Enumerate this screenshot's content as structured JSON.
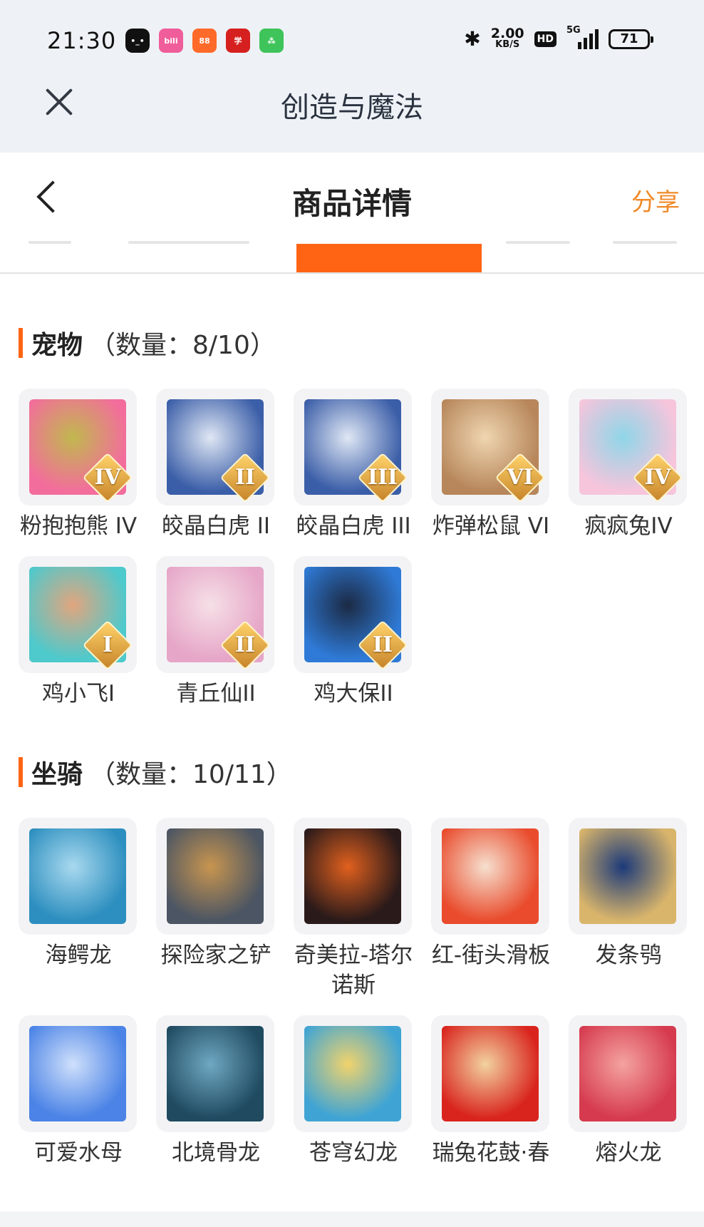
{
  "status_bar": {
    "time": "21:30",
    "notifications": [
      {
        "icon": "app-icon-black",
        "text": "•_•"
      },
      {
        "icon": "bilibili-icon",
        "text": "bili"
      },
      {
        "icon": "taobao-icon",
        "text": "88"
      },
      {
        "icon": "xuexi-icon",
        "text": "学"
      },
      {
        "icon": "wechat-app-icon",
        "text": "⁂"
      }
    ],
    "bluetooth": "✱",
    "speed_value": "2.00",
    "speed_unit": "KB/S",
    "hd": "HD",
    "network": "5G",
    "battery": "71"
  },
  "app_header": {
    "title": "创造与魔法"
  },
  "page_header": {
    "title": "商品详情",
    "share_label": "分享"
  },
  "pets": {
    "title": "宠物",
    "count": "（数量：8/10）",
    "items": [
      {
        "label": "粉抱抱熊 IV",
        "badge": "IV",
        "color1": "#f36d9c",
        "color2": "#c1b84e"
      },
      {
        "label": "皎晶白虎 II",
        "badge": "II",
        "color1": "#3b5ea8",
        "color2": "#dfe7f4"
      },
      {
        "label": "皎晶白虎 III",
        "badge": "III",
        "color1": "#3b5ea8",
        "color2": "#dfe7f4"
      },
      {
        "label": "炸弹松鼠 VI",
        "badge": "VI",
        "color1": "#b7865a",
        "color2": "#efd6b1"
      },
      {
        "label": "疯疯兔IV",
        "badge": "IV",
        "color1": "#f6c5dc",
        "color2": "#8fd6e8"
      },
      {
        "label": "鸡小飞I",
        "badge": "I",
        "color1": "#4ec9cc",
        "color2": "#e2a57e"
      },
      {
        "label": "青丘仙II",
        "badge": "II",
        "color1": "#e6a6c8",
        "color2": "#f6e0e6"
      },
      {
        "label": "鸡大保II",
        "badge": "II",
        "color1": "#2f7ad6",
        "color2": "#1b2a44"
      }
    ]
  },
  "mounts": {
    "title": "坐骑",
    "count": "（数量：10/11）",
    "items": [
      {
        "label": "海鳄龙",
        "color1": "#2d8fbf",
        "color2": "#a9d9ef"
      },
      {
        "label": "探险家之铲",
        "color1": "#4b5563",
        "color2": "#c8954f"
      },
      {
        "label": "奇美拉-塔尔诺斯",
        "color1": "#2a1a1a",
        "color2": "#e0601e"
      },
      {
        "label": "红-街头滑板",
        "color1": "#e94b2c",
        "color2": "#f6e0cf"
      },
      {
        "label": "发条鸮",
        "color1": "#d9b56b",
        "color2": "#1c3a7a"
      },
      {
        "label": "可爱水母",
        "color1": "#4b83e6",
        "color2": "#cfe0fb"
      },
      {
        "label": "北境骨龙",
        "color1": "#1f4a60",
        "color2": "#6fa8c2"
      },
      {
        "label": "苍穹幻龙",
        "color1": "#3fa4d4",
        "color2": "#f1d36c"
      },
      {
        "label": "瑞兔花鼓·春",
        "color1": "#d9241d",
        "color2": "#f2d2a0"
      },
      {
        "label": "熔火龙",
        "color1": "#d63a4f",
        "color2": "#f4a3a0"
      }
    ]
  }
}
